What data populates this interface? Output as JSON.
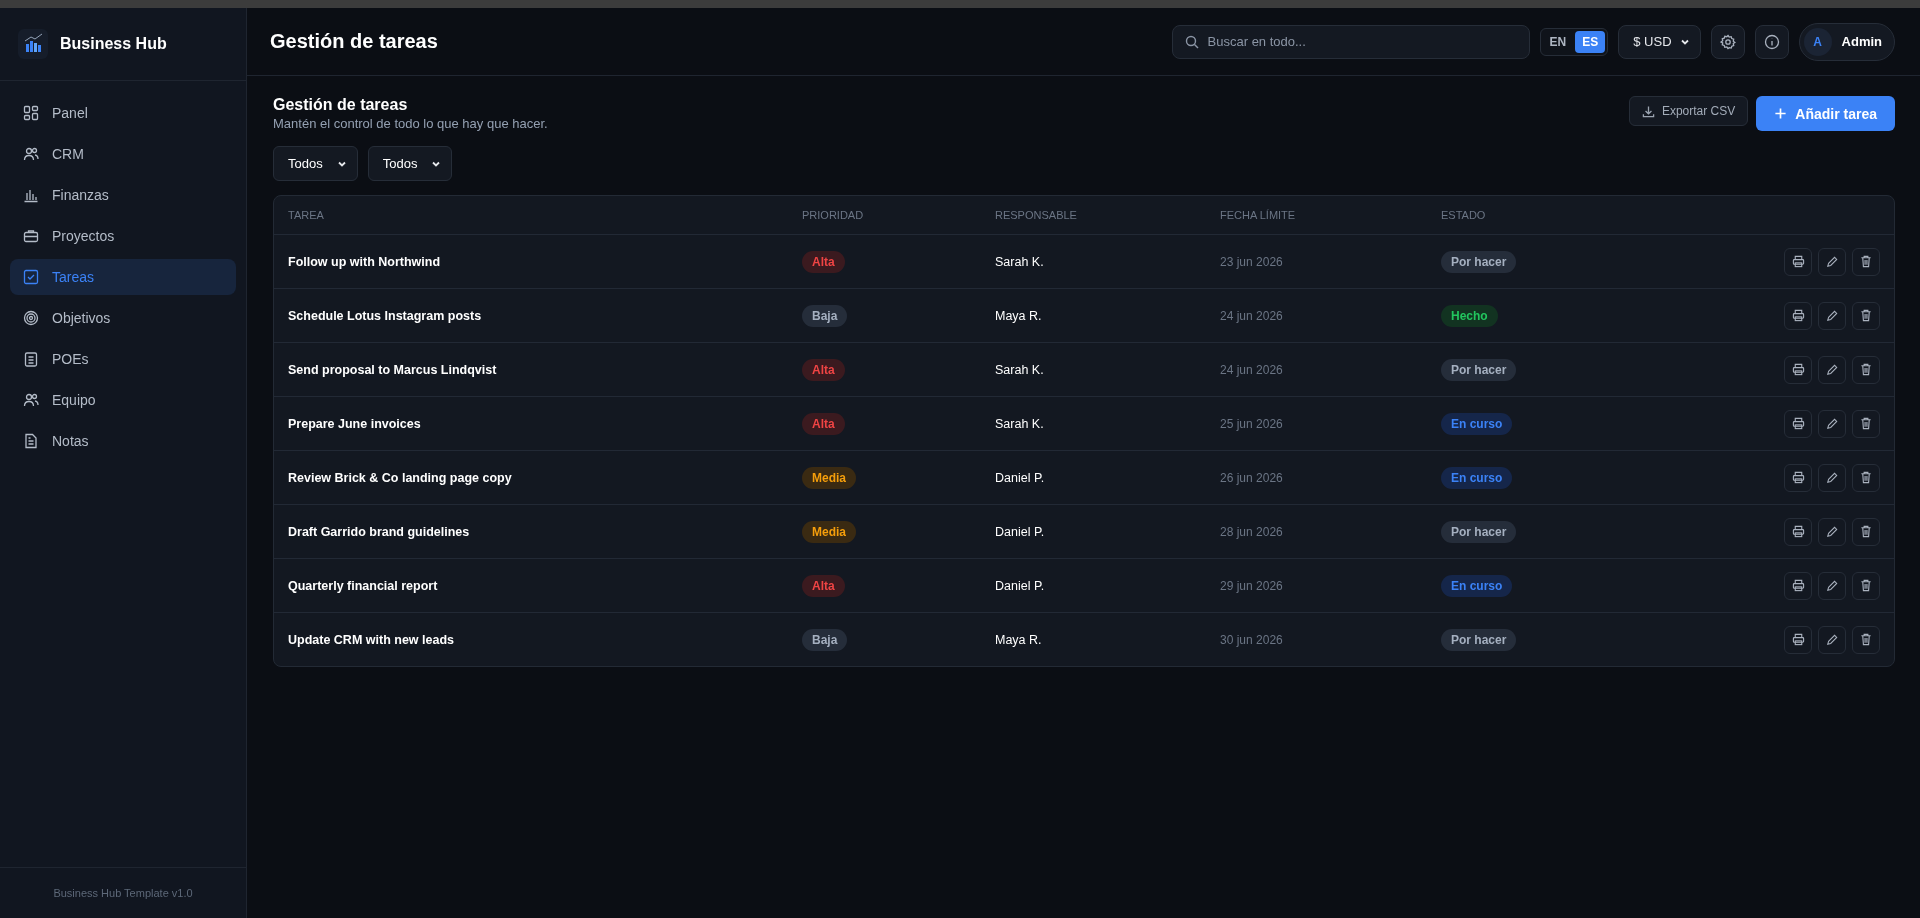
{
  "sidebar": {
    "brand": "Business Hub",
    "items": [
      {
        "label": "Panel",
        "selected": false
      },
      {
        "label": "CRM",
        "selected": false
      },
      {
        "label": "Finanzas",
        "selected": false
      },
      {
        "label": "Proyectos",
        "selected": false
      },
      {
        "label": "Tareas",
        "selected": true
      },
      {
        "label": "Objetivos",
        "selected": false
      },
      {
        "label": "POEs",
        "selected": false
      },
      {
        "label": "Equipo",
        "selected": false
      },
      {
        "label": "Notas",
        "selected": false
      }
    ],
    "footer": "Business Hub Template v1.0"
  },
  "header": {
    "title": "Gestión de tareas",
    "search": {
      "placeholder": "Buscar en todo..."
    },
    "languages": [
      {
        "label": "EN",
        "selected": false
      },
      {
        "label": "ES",
        "selected": true
      }
    ],
    "currency": "$ USD",
    "user": {
      "initial": "A",
      "name": "Admin"
    }
  },
  "page": {
    "title": "Gestión de tareas",
    "subtitle": "Mantén el control de todo lo que hay que hacer.",
    "export_button": "Exportar CSV",
    "add_button": "Añadir tarea",
    "filters": [
      "Todos",
      "Todos"
    ]
  },
  "table": {
    "columns": [
      "TAREA",
      "PRIORIDAD",
      "RESPONSABLE",
      "FECHA LÍMITE",
      "ESTADO"
    ],
    "rows": [
      {
        "task": "Follow up with Northwind",
        "priority": {
          "text": "Alta",
          "kind": "high"
        },
        "owner": "Sarah K.",
        "due": "23 jun 2026",
        "status": {
          "text": "Por hacer",
          "kind": "todo"
        }
      },
      {
        "task": "Schedule Lotus Instagram posts",
        "priority": {
          "text": "Baja",
          "kind": "low"
        },
        "owner": "Maya R.",
        "due": "24 jun 2026",
        "status": {
          "text": "Hecho",
          "kind": "done"
        }
      },
      {
        "task": "Send proposal to Marcus Lindqvist",
        "priority": {
          "text": "Alta",
          "kind": "high"
        },
        "owner": "Sarah K.",
        "due": "24 jun 2026",
        "status": {
          "text": "Por hacer",
          "kind": "todo"
        }
      },
      {
        "task": "Prepare June invoices",
        "priority": {
          "text": "Alta",
          "kind": "high"
        },
        "owner": "Sarah K.",
        "due": "25 jun 2026",
        "status": {
          "text": "En curso",
          "kind": "progress"
        }
      },
      {
        "task": "Review Brick & Co landing page copy",
        "priority": {
          "text": "Media",
          "kind": "medium"
        },
        "owner": "Daniel P.",
        "due": "26 jun 2026",
        "status": {
          "text": "En curso",
          "kind": "progress"
        }
      },
      {
        "task": "Draft Garrido brand guidelines",
        "priority": {
          "text": "Media",
          "kind": "medium"
        },
        "owner": "Daniel P.",
        "due": "28 jun 2026",
        "status": {
          "text": "Por hacer",
          "kind": "todo"
        }
      },
      {
        "task": "Quarterly financial report",
        "priority": {
          "text": "Alta",
          "kind": "high"
        },
        "owner": "Daniel P.",
        "due": "29 jun 2026",
        "status": {
          "text": "En curso",
          "kind": "progress"
        }
      },
      {
        "task": "Update CRM with new leads",
        "priority": {
          "text": "Baja",
          "kind": "low"
        },
        "owner": "Maya R.",
        "due": "30 jun 2026",
        "status": {
          "text": "Por hacer",
          "kind": "todo"
        }
      }
    ]
  }
}
